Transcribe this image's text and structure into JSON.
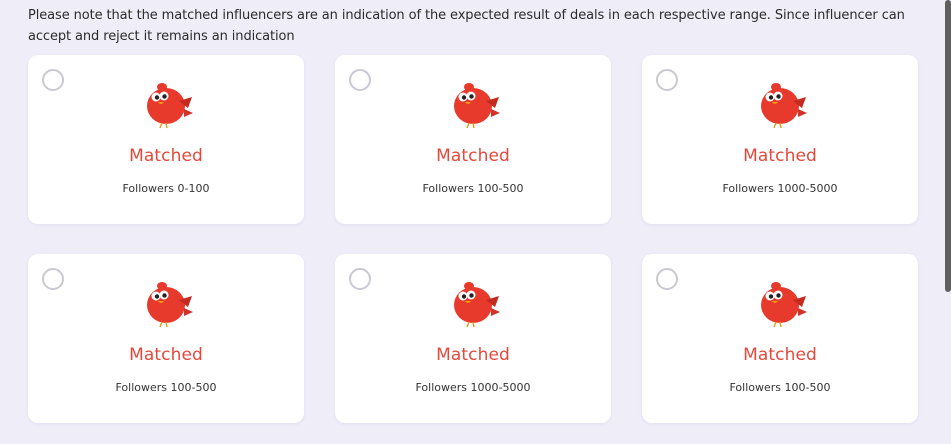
{
  "note": "Please note that the matched influencers are an indication of the expected result of deals in each respective range. Since influencer can accept and reject it remains an indication",
  "cards": [
    {
      "status": "Matched",
      "followers": "Followers  0-100",
      "icon": "red-bird-icon"
    },
    {
      "status": "Matched",
      "followers": "Followers  100-500",
      "icon": "red-bird-icon"
    },
    {
      "status": "Matched",
      "followers": "Followers  1000-5000",
      "icon": "red-bird-icon"
    },
    {
      "status": "Matched",
      "followers": "Followers  100-500",
      "icon": "red-bird-icon"
    },
    {
      "status": "Matched",
      "followers": "Followers  1000-5000",
      "icon": "red-bird-icon"
    },
    {
      "status": "Matched",
      "followers": "Followers  100-500",
      "icon": "red-bird-icon"
    }
  ],
  "colors": {
    "background": "#efedf8",
    "card": "#ffffff",
    "status_text": "#e5483b",
    "radio_border": "#c9c9d3"
  }
}
